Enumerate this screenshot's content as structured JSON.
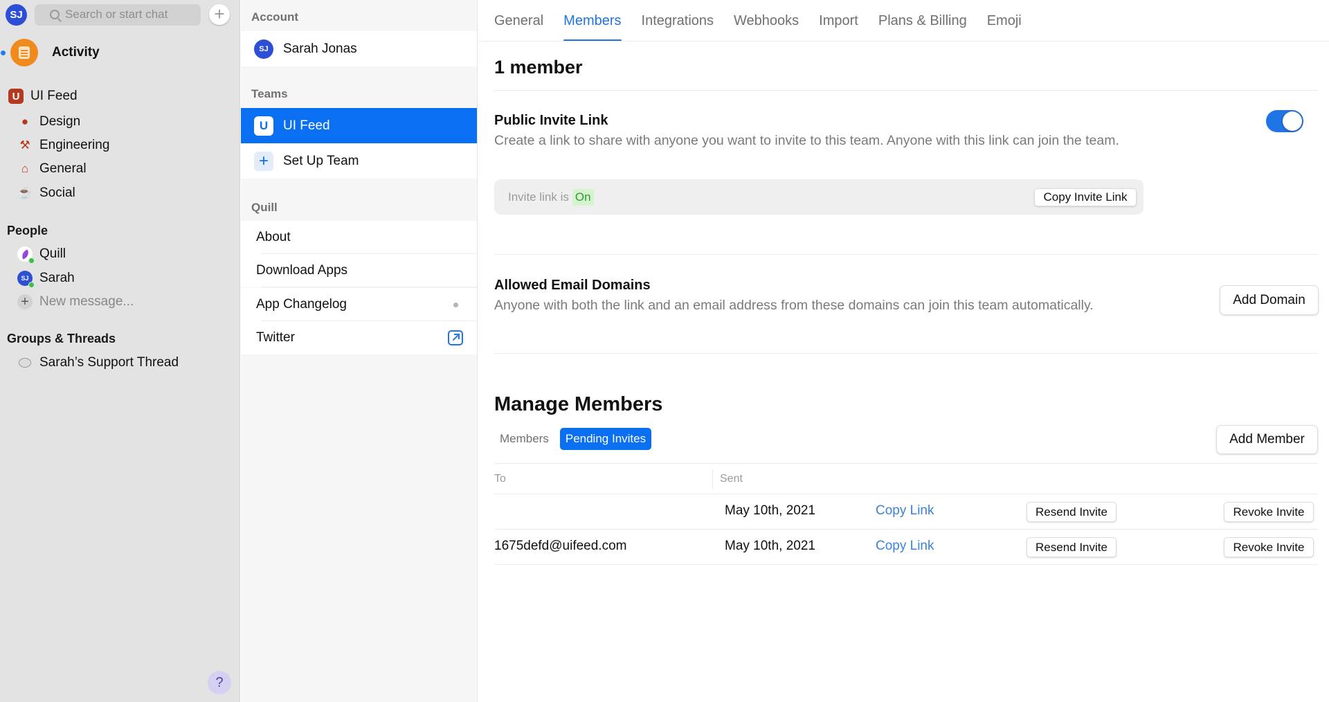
{
  "sidebar": {
    "user_initials": "SJ",
    "search_placeholder": "Search or start chat",
    "activity_label": "Activity",
    "team": {
      "initial": "U",
      "name": "UI Feed",
      "channels": [
        {
          "icon": "palette-icon",
          "glyph": "🎨",
          "label": "Design"
        },
        {
          "icon": "hammer-icon",
          "glyph": "⚒",
          "label": "Engineering"
        },
        {
          "icon": "house-icon",
          "glyph": "⌂",
          "label": "General"
        },
        {
          "icon": "coffee-icon",
          "glyph": "☕",
          "label": "Social"
        }
      ]
    },
    "people_heading": "People",
    "people": [
      {
        "name": "Quill",
        "online": true
      },
      {
        "name": "Sarah",
        "initials": "SJ",
        "online": true
      }
    ],
    "new_message_label": "New message...",
    "groups_heading": "Groups & Threads",
    "threads": [
      {
        "label": "Sarah’s Support Thread"
      }
    ],
    "help_label": "?"
  },
  "settings_nav": {
    "account_heading": "Account",
    "account": {
      "initials": "SJ",
      "name": "Sarah Jonas"
    },
    "teams_heading": "Teams",
    "teams": [
      {
        "initial": "U",
        "name": "UI Feed",
        "selected": true
      }
    ],
    "setup_team_label": "Set Up Team",
    "quill_heading": "Quill",
    "quill_links": [
      {
        "label": "About"
      },
      {
        "label": "Download Apps"
      },
      {
        "label": "App Changelog",
        "indicator": "dot"
      },
      {
        "label": "Twitter",
        "indicator": "external-link"
      }
    ]
  },
  "main": {
    "tabs": [
      {
        "label": "General",
        "active": false
      },
      {
        "label": "Members",
        "active": true
      },
      {
        "label": "Integrations",
        "active": false
      },
      {
        "label": "Webhooks",
        "active": false
      },
      {
        "label": "Import",
        "active": false
      },
      {
        "label": "Plans & Billing",
        "active": false
      },
      {
        "label": "Emoji",
        "active": false
      }
    ],
    "member_count": "1 member",
    "invite_link": {
      "title": "Public Invite Link",
      "description": "Create a link to share with anyone you want to invite to this team. Anyone with this link can join the team.",
      "enabled": true,
      "status_prefix": "Invite link is",
      "status_value": "On",
      "copy_button": "Copy Invite Link"
    },
    "email_domains": {
      "title": "Allowed Email Domains",
      "description": "Anyone with both the link and an email address from these domains can join this team automatically.",
      "add_button": "Add Domain"
    },
    "manage": {
      "title": "Manage Members",
      "subtabs": [
        {
          "label": "Members",
          "active": false
        },
        {
          "label": "Pending Invites",
          "active": true
        }
      ],
      "add_button": "Add Member",
      "columns": {
        "to": "To",
        "sent": "Sent"
      },
      "invites": [
        {
          "to": "",
          "sent": "May 10th, 2021",
          "copy": "Copy Link",
          "resend": "Resend Invite",
          "revoke": "Revoke Invite"
        },
        {
          "to": "1675defd@uifeed.com",
          "sent": "May 10th, 2021",
          "copy": "Copy Link",
          "resend": "Resend Invite",
          "revoke": "Revoke Invite"
        }
      ]
    }
  }
}
